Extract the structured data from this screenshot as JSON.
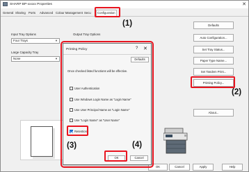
{
  "window": {
    "title": "SHARP BP-xxxxx Properties",
    "close_glyph": "✕"
  },
  "tabs": [
    "General",
    "Sharing",
    "Ports",
    "Advanced",
    "Colour Management",
    "Secu",
    "Configuration"
  ],
  "left": {
    "input_tray_label": "Input Tray Options",
    "input_tray_value": "Four Trays",
    "large_capacity_label": "Large Capacity Tray",
    "large_capacity_value": "None"
  },
  "output_tray_label": "Output Tray Options",
  "right_buttons": {
    "defaults": "Defaults",
    "auto_configuration": "Auto Configuration...",
    "set_tray_status": "Set Tray Status...",
    "paper_type_name": "Paper Type Name...",
    "set_tandem_print": "Set Tandem Print...",
    "printing_policy": "Printing Policy...",
    "about": "About..."
  },
  "bottom_buttons": {
    "ok": "OK",
    "cancel": "Cancel",
    "apply": "Apply",
    "help": "Help"
  },
  "dialog": {
    "title": "Printing Policy",
    "help_glyph": "?",
    "close_glyph": "✕",
    "defaults": "Defaults",
    "message": "Once checked listed functions will be effective.",
    "options": [
      {
        "label": "User Authentication",
        "checked": false
      },
      {
        "label": "Use Windows Login Name as \"Login Name\"",
        "checked": false
      },
      {
        "label": "Use User Principal Name as \"Login Name\"",
        "checked": false
      },
      {
        "label": "Use \"Login Name\" as \"User Name\"",
        "checked": false
      },
      {
        "label": "Retention",
        "checked": true
      }
    ],
    "ok": "OK",
    "cancel": "Cancel"
  },
  "callouts": [
    "(1)",
    "(2)",
    "(3)",
    "(4)"
  ],
  "colors": {
    "callout_red": "#e8141f",
    "checked_blue": "#1f6fd1"
  }
}
